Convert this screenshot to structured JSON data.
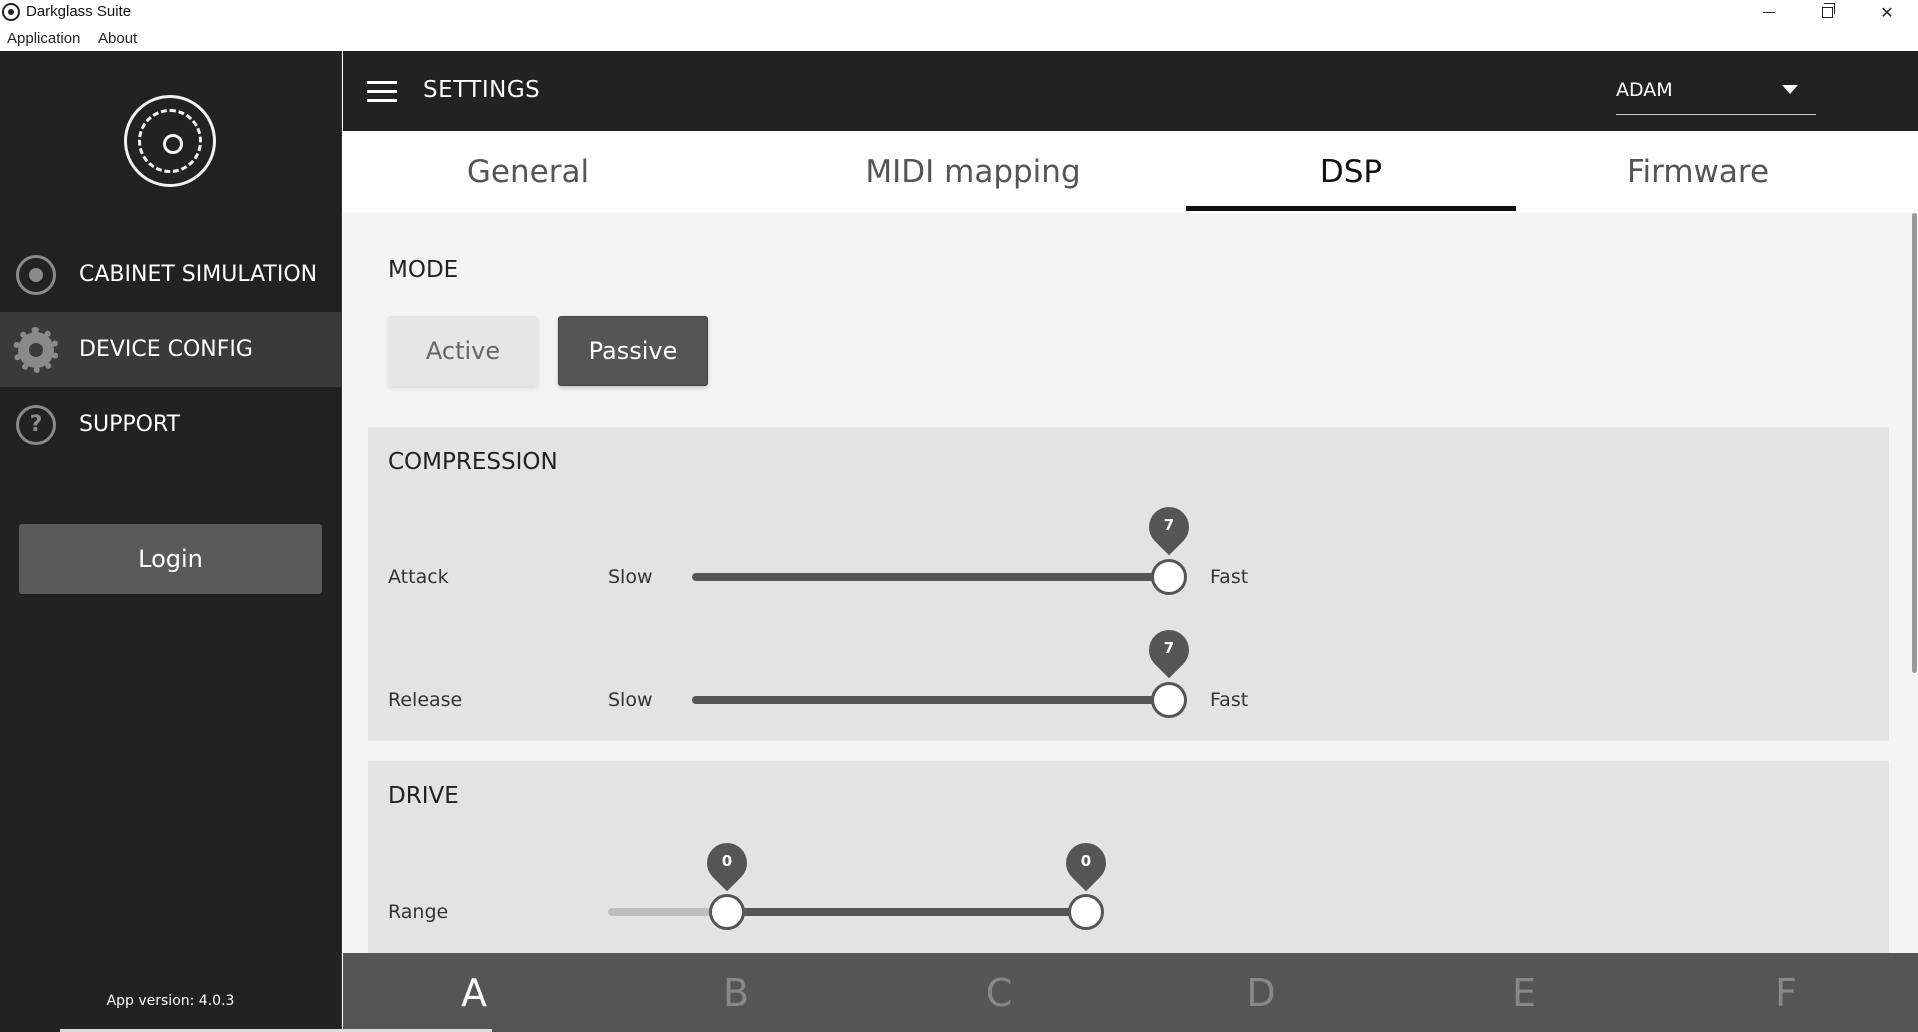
{
  "window": {
    "title": "Darkglass Suite",
    "minimize_icon": "minimize-icon",
    "maximize_icon": "restore-icon",
    "close_glyph": "✕"
  },
  "menu": {
    "items": [
      {
        "label": "Application"
      },
      {
        "label": "About"
      }
    ]
  },
  "sidebar": {
    "items": [
      {
        "label": "CABINET SIMULATION",
        "icon": "target-icon",
        "active": false
      },
      {
        "label": "DEVICE CONFIG",
        "icon": "gear-icon",
        "active": true
      },
      {
        "label": "SUPPORT",
        "icon": "question-icon",
        "active": false
      }
    ],
    "support_glyph": "?",
    "login_label": "Login",
    "app_version": "App version: 4.0.3"
  },
  "header": {
    "title": "SETTINGS",
    "user": "ADAM"
  },
  "tabs": [
    {
      "label": "General",
      "active": false
    },
    {
      "label": "MIDI mapping",
      "active": false
    },
    {
      "label": "DSP",
      "active": true
    },
    {
      "label": "Firmware",
      "active": false
    }
  ],
  "dsp": {
    "mode": {
      "title": "MODE",
      "options": [
        "Active",
        "Passive"
      ],
      "selected": "Passive"
    },
    "compression": {
      "title": "COMPRESSION",
      "attack": {
        "label": "Attack",
        "min_label": "Slow",
        "max_label": "Fast",
        "value": "7",
        "fraction": 1.0
      },
      "release": {
        "label": "Release",
        "min_label": "Slow",
        "max_label": "Fast",
        "value": "7",
        "fraction": 1.0
      }
    },
    "drive": {
      "title": "DRIVE",
      "range": {
        "label": "Range",
        "low_value": "0",
        "high_value": "0"
      }
    }
  },
  "presets": {
    "items": [
      "A",
      "B",
      "C",
      "D",
      "E",
      "F"
    ],
    "selected": "A"
  },
  "colors": {
    "sidebar_bg": "#222222",
    "active_nav_bg": "#3a3a3a",
    "accent_dark": "#555555",
    "panel_bg": "#e3e3e3"
  }
}
